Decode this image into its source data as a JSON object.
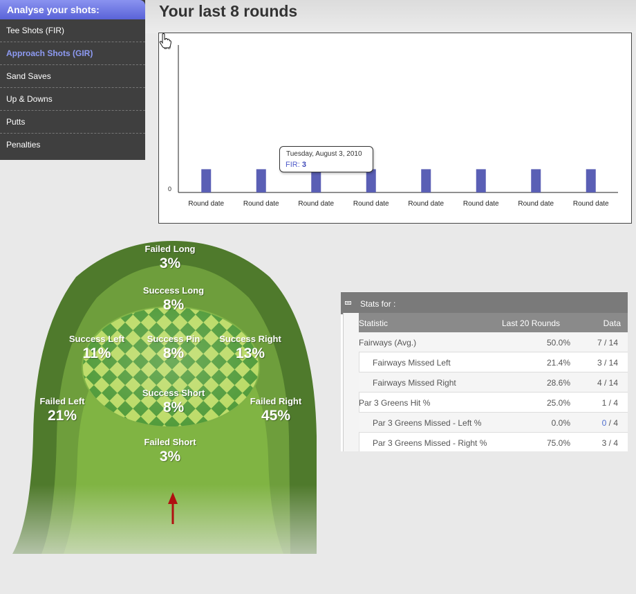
{
  "sidebar": {
    "title": "Analyse your shots:",
    "items": [
      {
        "label": "Tee Shots (FIR)",
        "active": false
      },
      {
        "label": "Approach Shots (GIR)",
        "active": true
      },
      {
        "label": "Sand Saves",
        "active": false
      },
      {
        "label": "Up & Downs",
        "active": false
      },
      {
        "label": "Putts",
        "active": false
      },
      {
        "label": "Penalties",
        "active": false
      }
    ]
  },
  "page": {
    "title": "Your last 8 rounds"
  },
  "chart_data": {
    "type": "bar",
    "categories": [
      "Round date",
      "Round date",
      "Round date",
      "Round date",
      "Round date",
      "Round date",
      "Round date",
      "Round date"
    ],
    "values": [
      8,
      8,
      8,
      8,
      8,
      8,
      8,
      8
    ],
    "ylim": [
      0,
      50
    ],
    "y_ticks": [
      "0",
      "50"
    ],
    "bar_color": "#5a5fb5",
    "grid": false,
    "tooltip": {
      "date": "Tuesday, August 3, 2010",
      "label": "FIR:",
      "value": "3"
    }
  },
  "green": {
    "zones": [
      {
        "id": "failed-long",
        "name": "Failed Long",
        "pct": "3%"
      },
      {
        "id": "success-long",
        "name": "Success Long",
        "pct": "8%"
      },
      {
        "id": "success-left",
        "name": "Success Left",
        "pct": "11%"
      },
      {
        "id": "success-pin",
        "name": "Success Pin",
        "pct": "8%"
      },
      {
        "id": "success-right",
        "name": "Success Right",
        "pct": "13%"
      },
      {
        "id": "success-short",
        "name": "Success Short",
        "pct": "8%"
      },
      {
        "id": "failed-left",
        "name": "Failed Left",
        "pct": "21%"
      },
      {
        "id": "failed-right",
        "name": "Failed Right",
        "pct": "45%"
      },
      {
        "id": "failed-short",
        "name": "Failed Short",
        "pct": "3%"
      }
    ],
    "colors": {
      "outer": "#4f7a2c",
      "fringe": "#6b9a3a",
      "fairway": "#7fb342",
      "check_dark": "#4f9a38",
      "check_light": "#b3d65a",
      "arrow": "#b01010"
    }
  },
  "stats": {
    "title": "Stats for :",
    "columns": {
      "statistic": "Statistic",
      "last": "Last 20 Rounds",
      "data": "Data"
    },
    "rows": [
      {
        "name": "Fairways (Avg.)",
        "last": "50.0%",
        "num": "7",
        "den": "/ 14",
        "indent": false
      },
      {
        "name": "Fairways Missed Left",
        "last": "21.4%",
        "num": "3",
        "den": "/ 14",
        "indent": true
      },
      {
        "name": "Fairways Missed Right",
        "last": "28.6%",
        "num": "4",
        "den": "/ 14",
        "indent": true
      },
      {
        "name": "Par 3 Greens Hit %",
        "last": "25.0%",
        "num": "1",
        "den": "/ 4",
        "indent": false
      },
      {
        "name": "Par 3 Greens Missed - Left %",
        "last": "0.0%",
        "num": "0",
        "den": "/ 4",
        "indent": true
      },
      {
        "name": "Par 3 Greens Missed - Right %",
        "last": "75.0%",
        "num": "3",
        "den": "/ 4",
        "indent": true
      }
    ]
  }
}
